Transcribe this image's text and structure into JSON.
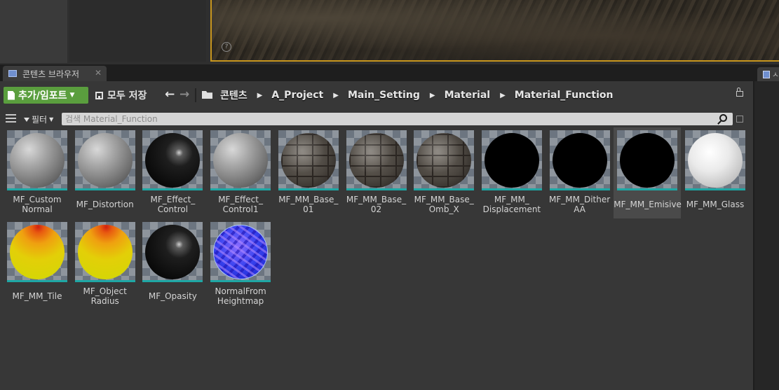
{
  "tabs": {
    "content_browser": "콘텐츠 브라우저",
    "close_glyph": "✕",
    "right_tab_partial": "ㅅ"
  },
  "toolbar": {
    "add_import_label": "추가/임포트",
    "save_all_label": "모두 저장",
    "back_glyph": "🡐",
    "forward_glyph": "🡒"
  },
  "breadcrumb": [
    "콘텐츠",
    "A_Project",
    "Main_Setting",
    "Material",
    "Material_Function"
  ],
  "breadcrumb_separator": "▶",
  "filter": {
    "filter_label": "필터",
    "search_placeholder": "검색 Material_Function"
  },
  "viewport": {
    "help_glyph": "?"
  },
  "colors": {
    "accent_green": "#5a9e3e",
    "viewport_border": "#c8961e",
    "asset_type_bar": "#1fa7a5"
  },
  "assets": [
    {
      "name": "MF_Custom\nNormal",
      "thumbnail": "gray-checker-sphere"
    },
    {
      "name": "MF_Distortion",
      "thumbnail": "gray-checker-sphere"
    },
    {
      "name": "MF_Effect_\nControl",
      "thumbnail": "black-glossy-sphere"
    },
    {
      "name": "MF_Effect_\nControl1",
      "thumbnail": "gray-checker-sphere"
    },
    {
      "name": "MF_MM_Base_\n01",
      "thumbnail": "stone-brick-sphere"
    },
    {
      "name": "MF_MM_Base_\n02",
      "thumbnail": "stone-brick-sphere"
    },
    {
      "name": "MF_MM_Base_\nOmb_X",
      "thumbnail": "stone-brick-sphere"
    },
    {
      "name": "MF_MM_\nDisplacement",
      "thumbnail": "black-sphere"
    },
    {
      "name": "MF_MM_Dither\nAA",
      "thumbnail": "black-sphere"
    },
    {
      "name": "MF_MM_Emisive",
      "thumbnail": "black-sphere",
      "selected": true
    },
    {
      "name": "MF_MM_Glass",
      "thumbnail": "white-sphere"
    },
    {
      "name": "MF_MM_Tile",
      "thumbnail": "yellow-sphere"
    },
    {
      "name": "MF_Object\nRadius",
      "thumbnail": "yellow-sphere"
    },
    {
      "name": "MF_Opasity",
      "thumbnail": "black-glossy-sphere"
    },
    {
      "name": "NormalFrom\nHeightmap",
      "thumbnail": "blue-noise-sphere"
    }
  ]
}
